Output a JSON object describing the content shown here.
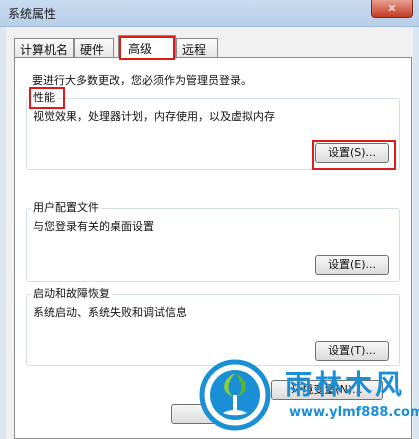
{
  "window": {
    "title": "系统属性",
    "close_label": "✕"
  },
  "tabs": [
    {
      "label": "计算机名",
      "active": false
    },
    {
      "label": "硬件",
      "active": false
    },
    {
      "label": "高级",
      "active": true
    },
    {
      "label": "远程",
      "active": false
    }
  ],
  "advanced": {
    "admin_note": "要进行大多数更改，您必须作为管理员登录。",
    "performance": {
      "label": "性能",
      "description": "视觉效果，处理器计划，内存使用，以及虚拟内存",
      "button": "设置(S)..."
    },
    "user_profiles": {
      "label": "用户配置文件",
      "description": "与您登录有关的桌面设置",
      "button": "设置(E)..."
    },
    "startup_recovery": {
      "label": "启动和故障恢复",
      "description": "系统启动、系统失败和调试信息",
      "button": "设置(T)..."
    },
    "env_button": "环境变量(N)..."
  },
  "watermark": {
    "title": "雨林木风",
    "url": "www.ylmf888.com"
  },
  "colors": {
    "highlight": "#e01a1a",
    "brand": "#1b8fd6"
  }
}
